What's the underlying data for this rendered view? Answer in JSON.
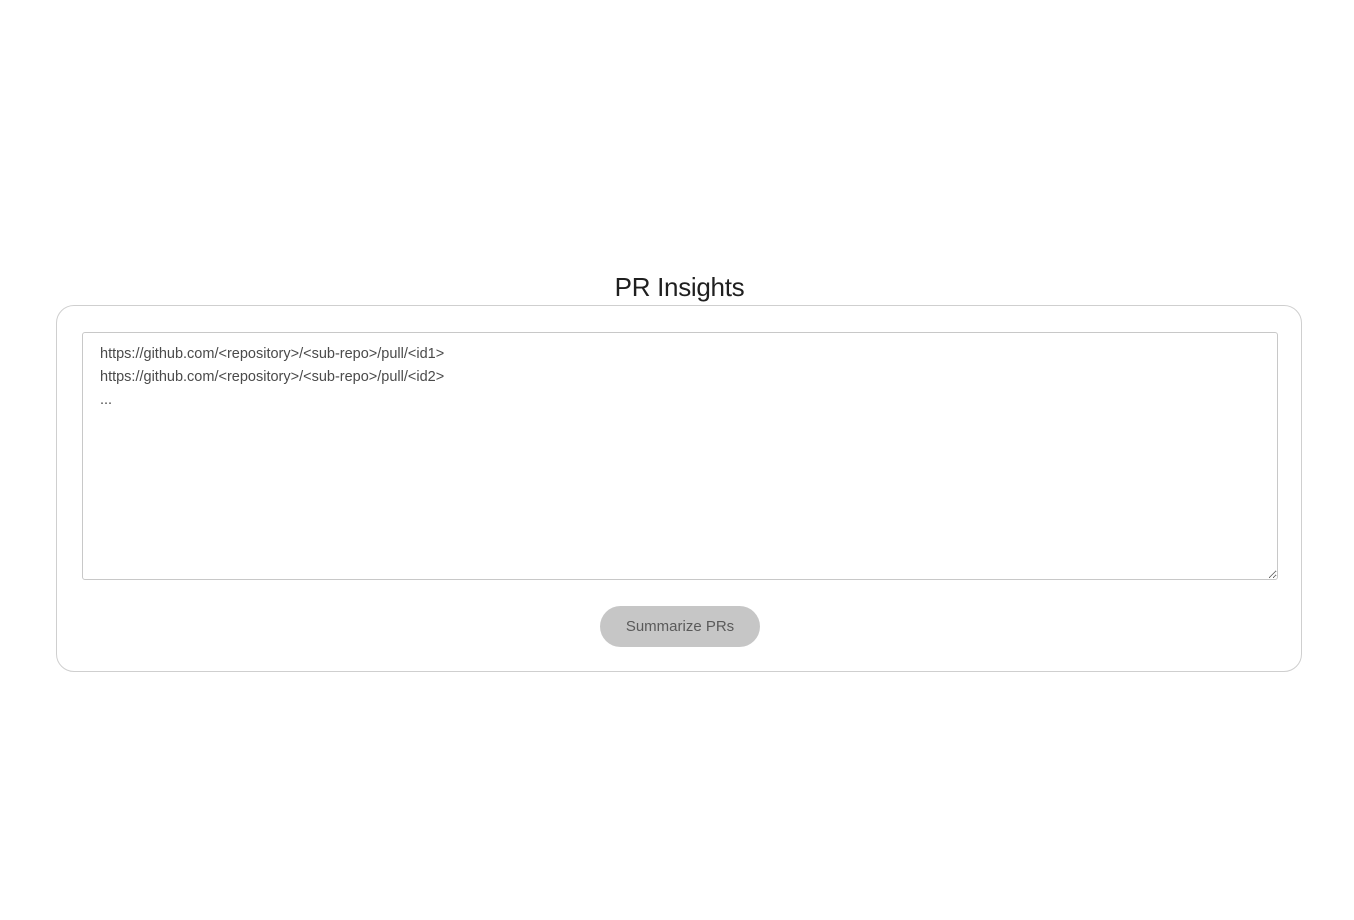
{
  "header": {
    "title": "PR Insights"
  },
  "form": {
    "pr_urls_placeholder": "https://github.com/<repository>/<sub-repo>/pull/<id1>\nhttps://github.com/<repository>/<sub-repo>/pull/<id2>\n...",
    "pr_urls_value": "",
    "submit_label": "Summarize PRs"
  },
  "colors": {
    "title_text": "#1f1f1f",
    "card_border": "#cfcfcf",
    "button_background": "#c6c6c6",
    "button_text": "#5a5a5a"
  }
}
